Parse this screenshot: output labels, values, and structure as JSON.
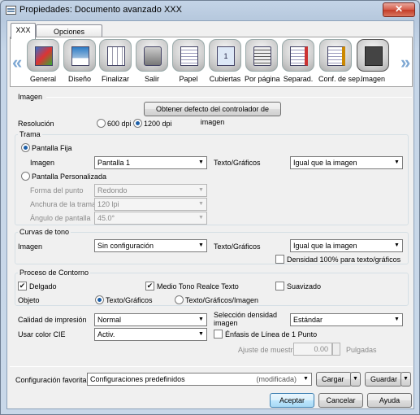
{
  "window": {
    "title": "Propiedades: Documento avanzado XXX",
    "close": "✕"
  },
  "tabs": [
    "XXX",
    "Opciones avanzadas"
  ],
  "toolbar": {
    "left_arrow": "«",
    "right_arrow": "»",
    "items": [
      "General",
      "Diseño",
      "Finalizar",
      "Salir",
      "Papel",
      "Cubiertas",
      "Por página",
      "Separad.",
      "Conf. de sep.",
      "Imagen"
    ]
  },
  "imagen": {
    "group_title": "Imagen",
    "default_button": "Obtener defecto del controlador de imagen",
    "resolucion_label": "Resolución",
    "res_600": "600 dpi",
    "res_1200": "1200 dpi"
  },
  "trama": {
    "group_title": "Trama",
    "pantalla_fija": "Pantalla Fija",
    "imagen_label": "Imagen",
    "imagen_value": "Pantalla 1",
    "texto_label": "Texto/Gráficos",
    "texto_value": "Igual que la imagen",
    "pantalla_personalizada": "Pantalla Personalizada",
    "forma_label": "Forma del punto",
    "forma_value": "Redondo",
    "anchura_label": "Anchura de la trama",
    "anchura_value": "120 lpi",
    "angulo_label": "Ángulo de pantalla",
    "angulo_value": "45.0°"
  },
  "curvas": {
    "group_title": "Curvas de tono",
    "imagen_label": "Imagen",
    "imagen_value": "Sin configuración",
    "texto_label": "Texto/Gráficos",
    "texto_value": "Igual que la imagen",
    "densidad": "Densidad 100% para texto/gráficos"
  },
  "contorno": {
    "group_title": "Proceso de Contorno",
    "delgado": "Delgado",
    "medio_tono": "Medio Tono Realce Texto",
    "suavizado": "Suavizado",
    "objeto_label": "Objeto",
    "obj_texto": "Texto/Gráficos",
    "obj_texto_imagen": "Texto/Gráficos/Imagen"
  },
  "calidad": {
    "label": "Calidad de impresión",
    "value": "Normal",
    "seleccion_label": "Selección densidad imagen",
    "seleccion_value": "Estándar"
  },
  "cie": {
    "label": "Usar color CIE",
    "value": "Activ.",
    "enfasis": "Énfasis de Línea de 1 Punto",
    "ajuste_label": "Ajuste de muestra",
    "ajuste_value": "0.00",
    "ajuste_unit": "Pulgadas"
  },
  "favorita": {
    "label": "Configuración favorita",
    "value": "Configuraciones predefinidos",
    "status": "(modificada)",
    "cargar": "Cargar",
    "guardar": "Guardar"
  },
  "footer": {
    "aceptar": "Aceptar",
    "cancelar": "Cancelar",
    "ayuda": "Ayuda"
  },
  "glyphs": {
    "dropdown": "▼",
    "check": "✔"
  }
}
